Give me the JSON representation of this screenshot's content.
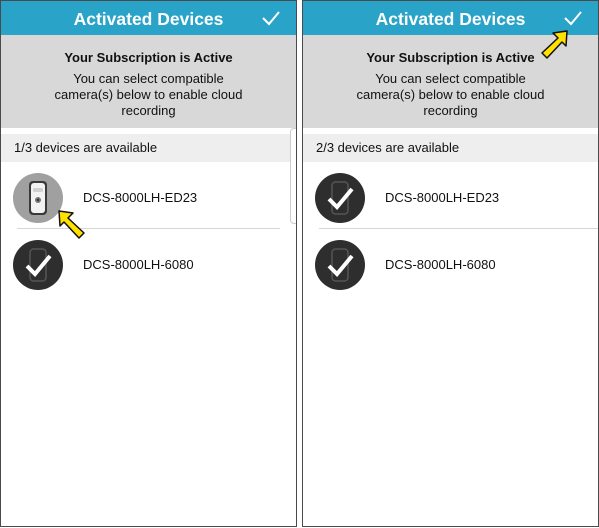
{
  "colors": {
    "accent": "#2aa3c9",
    "banner": "#d8d8d8",
    "avatar_dark": "#2e2e2e",
    "avatar_light": "#a0a0a0",
    "pointer": "#ffe100"
  },
  "panels": [
    {
      "appbar": {
        "title": "Activated Devices",
        "confirm_icon": "checkmark-icon"
      },
      "banner": {
        "title": "Your Subscription is Active",
        "description": "You can select compatible camera(s) below to enable cloud recording"
      },
      "count_text": "1/3 devices are available",
      "devices": [
        {
          "name": "DCS-8000LH-ED23",
          "selected": false
        },
        {
          "name": "DCS-8000LH-6080",
          "selected": true
        }
      ]
    },
    {
      "appbar": {
        "title": "Activated Devices",
        "confirm_icon": "checkmark-icon"
      },
      "banner": {
        "title": "Your Subscription is Active",
        "description": "You can select compatible camera(s) below to enable cloud recording"
      },
      "count_text": "2/3 devices are available",
      "devices": [
        {
          "name": "DCS-8000LH-ED23",
          "selected": true
        },
        {
          "name": "DCS-8000LH-6080",
          "selected": true
        }
      ]
    }
  ]
}
